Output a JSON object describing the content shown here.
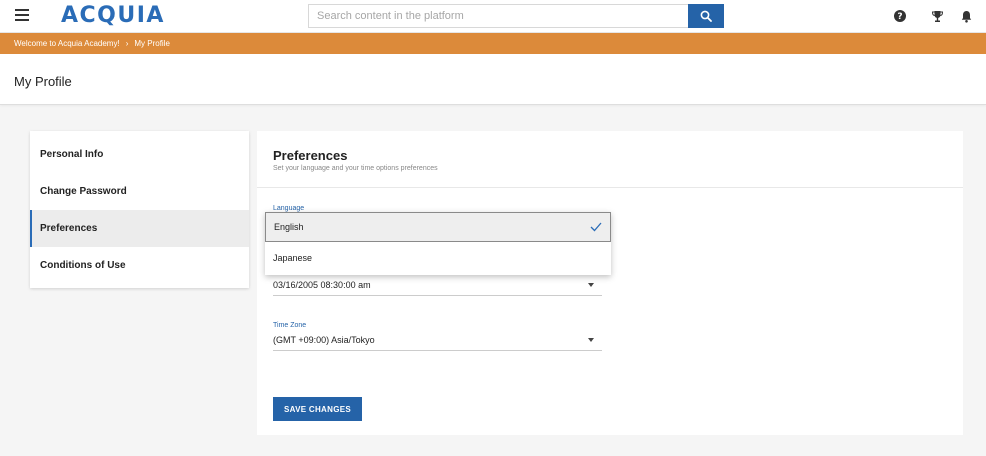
{
  "header": {
    "logo": "ACQUIA",
    "search_placeholder": "Search content in the platform",
    "icons": [
      "menu-icon",
      "search-icon",
      "help-icon",
      "trophy-icon",
      "bell-icon"
    ]
  },
  "breadcrumb": {
    "items": [
      "Welcome to Acquia Academy!",
      "My Profile"
    ],
    "separator": "›"
  },
  "page": {
    "title": "My Profile"
  },
  "sidebar": {
    "items": [
      {
        "label": "Personal Info"
      },
      {
        "label": "Change Password"
      },
      {
        "label": "Preferences"
      },
      {
        "label": "Conditions of Use"
      }
    ],
    "active": "Preferences"
  },
  "preferences": {
    "title": "Preferences",
    "subtitle": "Set your language and your time options preferences",
    "language": {
      "label": "Language",
      "options": [
        "English",
        "Japanese"
      ],
      "selected": "English"
    },
    "date_format": {
      "value": "03/16/2005 08:30:00 am"
    },
    "time_zone": {
      "label": "Time Zone",
      "value": "(GMT +09:00) Asia/Tokyo"
    },
    "save_label": "SAVE CHANGES"
  },
  "colors": {
    "brand_blue": "#2a6cb7",
    "breadcrumb_orange": "#dc8a3a",
    "button_blue": "#2563a8"
  }
}
